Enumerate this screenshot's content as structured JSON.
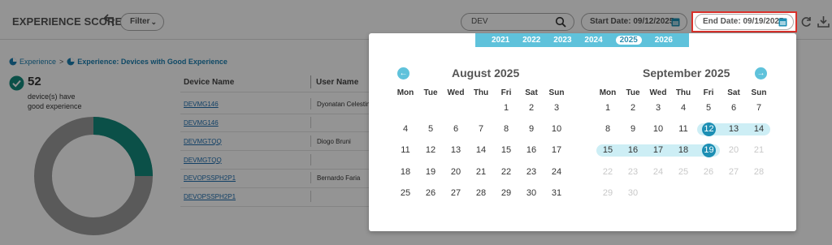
{
  "header": {
    "title": "EXPERIENCE SCORE",
    "filter_label": "Filter",
    "search_value": "DEV",
    "start_date_label": "Start Date: 09/12/2025",
    "end_date_label": "End Date: 09/19/2025"
  },
  "breadcrumb": {
    "items": [
      "Experience",
      "Experience: Devices with Good Experience"
    ],
    "separator": ">"
  },
  "stat": {
    "count": "52",
    "text": "device(s) have good experience"
  },
  "donut": {
    "good_fraction": 0.25,
    "good_color": "#148a7c",
    "other_color": "#9b9b9b"
  },
  "table": {
    "headers": [
      "Device Name",
      "User Name"
    ],
    "rows": [
      {
        "device": "DEVMG146",
        "user": "Dyonatan Celestin"
      },
      {
        "device": "DEVMG146",
        "user": ""
      },
      {
        "device": "DEVMGTQQ",
        "user": "Diogo Bruni"
      },
      {
        "device": "DEVMGTQQ",
        "user": ""
      },
      {
        "device": "DEVOPSSPH2P1",
        "user": "Bernardo Faria"
      },
      {
        "device": "DEVOPSSPH2P1",
        "user": ""
      }
    ]
  },
  "calendar": {
    "years": [
      "2021",
      "2022",
      "2023",
      "2024",
      "2025",
      "2026"
    ],
    "selected_year": "2025",
    "weekdays": [
      "Mon",
      "Tue",
      "Wed",
      "Thu",
      "Fri",
      "Sat",
      "Sun"
    ],
    "left_month": {
      "title": "August 2025",
      "weeks": [
        [
          "",
          "",
          "",
          "",
          "1",
          "2",
          "3"
        ],
        [
          "4",
          "5",
          "6",
          "7",
          "8",
          "9",
          "10"
        ],
        [
          "11",
          "12",
          "13",
          "14",
          "15",
          "16",
          "17"
        ],
        [
          "18",
          "19",
          "20",
          "21",
          "22",
          "23",
          "24"
        ],
        [
          "25",
          "26",
          "27",
          "28",
          "29",
          "30",
          "31"
        ]
      ]
    },
    "right_month": {
      "title": "September 2025",
      "weeks": [
        [
          "1",
          "2",
          "3",
          "4",
          "5",
          "6",
          "7"
        ],
        [
          "8",
          "9",
          "10",
          "11",
          "12",
          "13",
          "14"
        ],
        [
          "15",
          "16",
          "17",
          "18",
          "19",
          "20",
          "21"
        ],
        [
          "22",
          "23",
          "24",
          "25",
          "26",
          "27",
          "28"
        ],
        [
          "29",
          "30",
          "",
          "",
          "",
          "",
          ""
        ]
      ],
      "range_start": "12",
      "range_end": "19",
      "disabled_after": "19"
    },
    "colors": {
      "accent": "#5fc2db",
      "selected": "#1d8fb4",
      "range": "#cdeef5",
      "highlight_border": "#d9312b"
    }
  }
}
